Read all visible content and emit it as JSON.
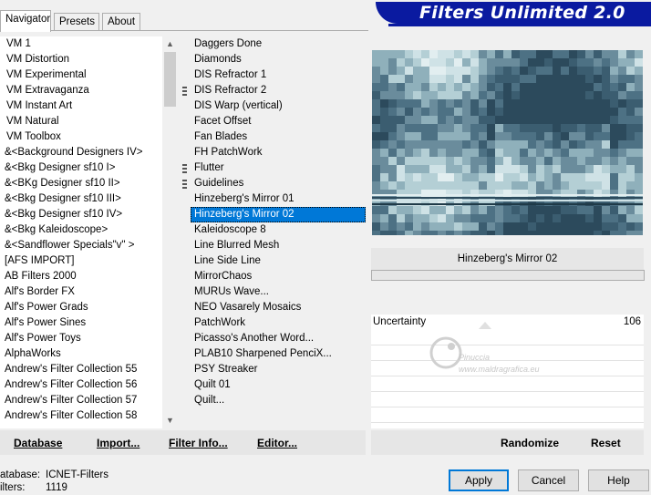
{
  "tabs": [
    {
      "label": "Navigator",
      "active": true
    },
    {
      "label": "Presets",
      "active": false
    },
    {
      "label": "About",
      "active": false
    }
  ],
  "banner": {
    "title": "Filters Unlimited 2.0",
    "color": "#0a1aa0"
  },
  "categories": [
    "VM 1",
    "VM Distortion",
    "VM Experimental",
    "VM Extravaganza",
    "VM Instant Art",
    "VM Natural",
    "VM Toolbox",
    "&<Background Designers IV>",
    "&<Bkg Designer sf10 I>",
    "&<BKg Designer sf10 II>",
    "&<Bkg Designer sf10 III>",
    "&<Bkg Designer sf10 IV>",
    "&<Bkg Kaleidoscope>",
    "&<Sandflower Specials\"v\" >",
    "[AFS IMPORT]",
    "AB Filters 2000",
    "Alf's Border FX",
    "Alf's Power Grads",
    "Alf's Power Sines",
    "Alf's Power Toys",
    "AlphaWorks",
    "Andrew's Filter Collection 55",
    "Andrew's Filter Collection 56",
    "Andrew's Filter Collection 57",
    "Andrew's Filter Collection 58"
  ],
  "filters": [
    {
      "label": "Daggers Done",
      "grip": false
    },
    {
      "label": "Diamonds",
      "grip": false
    },
    {
      "label": "DIS Refractor 1",
      "grip": false
    },
    {
      "label": "DIS Refractor 2",
      "grip": true
    },
    {
      "label": "DIS Warp (vertical)",
      "grip": false
    },
    {
      "label": "Facet Offset",
      "grip": false
    },
    {
      "label": "Fan Blades",
      "grip": false
    },
    {
      "label": "FH PatchWork",
      "grip": false
    },
    {
      "label": "Flutter",
      "grip": true
    },
    {
      "label": "Guidelines",
      "grip": true
    },
    {
      "label": "Hinzeberg's Mirror 01",
      "grip": false
    },
    {
      "label": "Hinzeberg's Mirror 02",
      "grip": false,
      "selected": true
    },
    {
      "label": "Kaleidoscope 8",
      "grip": false
    },
    {
      "label": "Line Blurred Mesh",
      "grip": false
    },
    {
      "label": "Line Side Line",
      "grip": false
    },
    {
      "label": "MirrorChaos",
      "grip": false
    },
    {
      "label": "MURUs Wave...",
      "grip": false
    },
    {
      "label": "NEO Vasarely Mosaics",
      "grip": false
    },
    {
      "label": "PatchWork",
      "grip": false
    },
    {
      "label": "Picasso's Another Word...",
      "grip": false
    },
    {
      "label": "PLAB10 Sharpened PenciX...",
      "grip": false
    },
    {
      "label": "PSY Streaker",
      "grip": false
    },
    {
      "label": "Quilt 01",
      "grip": false
    },
    {
      "label": "Quilt...",
      "grip": false
    }
  ],
  "selected_filter": "Hinzeberg's Mirror 02",
  "parameter": {
    "name": "Uncertainty",
    "value": "106"
  },
  "bottom_left_buttons": {
    "database": "Database",
    "import": "Import...",
    "filter_info": "Filter Info...",
    "editor": "Editor..."
  },
  "bottom_right_buttons": {
    "randomize": "Randomize",
    "reset": "Reset"
  },
  "status": {
    "database_label": "atabase:",
    "database_value": "ICNET-Filters",
    "filters_label": "ilters:",
    "filters_value": "1119"
  },
  "dialog_buttons": {
    "apply": "Apply",
    "cancel": "Cancel",
    "help": "Help"
  },
  "watermark": {
    "line1": "Pinuccia",
    "line2": "www.maldragrafica.eu"
  },
  "colors": {
    "selection": "#0078d7",
    "preview_dark": "#2c4a5c",
    "preview_light": "#c8dde2"
  }
}
